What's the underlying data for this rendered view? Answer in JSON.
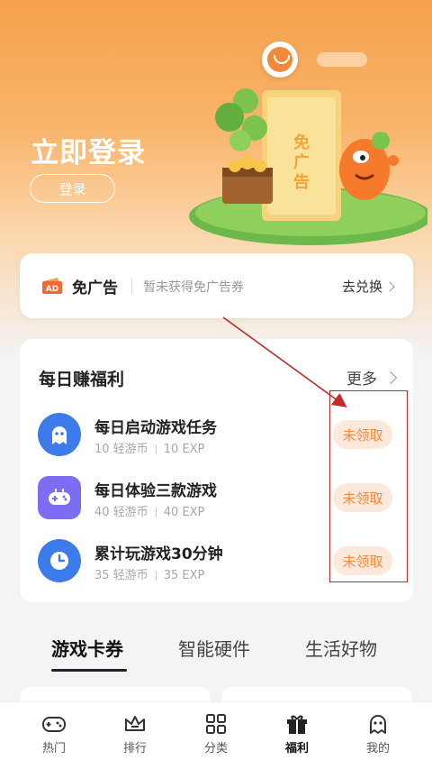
{
  "header": {
    "login_title": "立即登录",
    "login_button": "登录"
  },
  "illustration": {
    "ticket_text": "免广告"
  },
  "ad_free": {
    "icon_text": "AD",
    "title": "免广告",
    "subtitle": "暂未获得免广告券",
    "link": "去兑换"
  },
  "daily": {
    "title": "每日赚福利",
    "more": "更多",
    "tasks": [
      {
        "name": "每日启动游戏任务",
        "coins": "10 轻游币",
        "exp": "10 EXP",
        "button": "未领取",
        "icon": "ghost-icon",
        "color": "#3e7bea"
      },
      {
        "name": "每日体验三款游戏",
        "coins": "40 轻游币",
        "exp": "40 EXP",
        "button": "未领取",
        "icon": "gamepad-icon",
        "color": "#7c6df2"
      },
      {
        "name": "累计玩游戏30分钟",
        "coins": "35 轻游币",
        "exp": "35 EXP",
        "button": "未领取",
        "icon": "clock-icon",
        "color": "#3e7bea"
      }
    ]
  },
  "tabs": [
    "游戏卡券",
    "智能硬件",
    "生活好物"
  ],
  "bottom_nav": [
    {
      "label": "热门",
      "icon": "gamepad-icon"
    },
    {
      "label": "排行",
      "icon": "crown-icon"
    },
    {
      "label": "分类",
      "icon": "grid-icon"
    },
    {
      "label": "福利",
      "icon": "gift-icon",
      "active": true
    },
    {
      "label": "我的",
      "icon": "ghost-icon"
    }
  ],
  "colors": {
    "accent": "#f0883e",
    "hero_top": "#f6a24c",
    "annotation_red": "#c42a2a"
  }
}
